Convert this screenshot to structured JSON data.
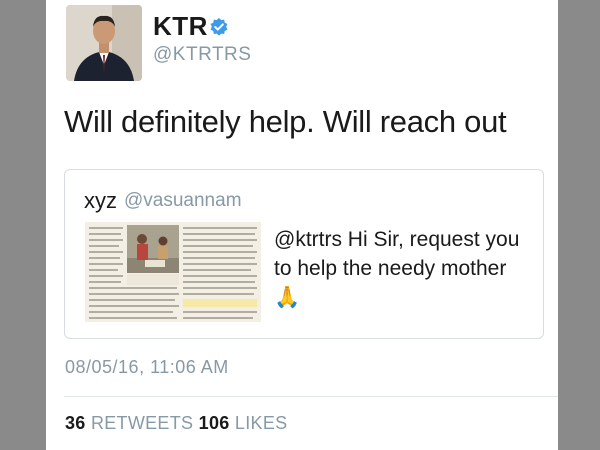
{
  "tweet": {
    "author_name": "KTR",
    "author_handle": "@KTRTRS",
    "text": "Will definitely help. Will reach out",
    "timestamp": "08/05/16, 11:06 AM"
  },
  "quoted_tweet": {
    "author_name": "xyz",
    "author_handle": "@vasuannam",
    "text": "@ktrtrs Hi Sir, request you to help the needy mother🙏"
  },
  "stats": {
    "retweets_count": "36",
    "retweets_label": "RETWEETS",
    "likes_count": "106",
    "likes_label": "LIKES"
  },
  "colors": {
    "verified": "#3d9be9",
    "muted_text": "#8899a6",
    "border": "#d6dde3"
  }
}
